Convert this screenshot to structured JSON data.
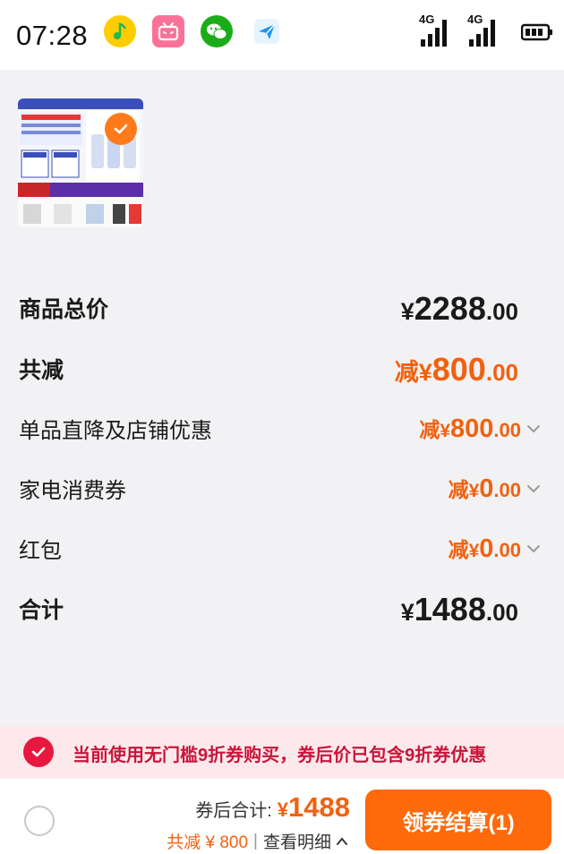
{
  "status_bar": {
    "time": "07:28",
    "apps": [
      "music-icon",
      "bilibili-icon",
      "wechat-icon",
      "send-icon"
    ],
    "signal_1_label": "4G",
    "signal_2_label": "4G"
  },
  "rows": {
    "product_total": {
      "label": "商品总价",
      "yen": "¥",
      "int": "2288",
      "dec": ".00"
    },
    "total_reduction": {
      "label": "共减",
      "prefix": "减",
      "yen": "¥",
      "int": "800",
      "dec": ".00"
    },
    "store_discount": {
      "label": "单品直降及店铺优惠",
      "prefix": "减",
      "yen": "¥",
      "int": "800",
      "dec": ".00"
    },
    "appliance_coupon": {
      "label": "家电消费券",
      "prefix": "减",
      "yen": "¥",
      "int": "0",
      "dec": ".00"
    },
    "red_packet": {
      "label": "红包",
      "prefix": "减",
      "yen": "¥",
      "int": "0",
      "dec": ".00"
    },
    "grand_total": {
      "label": "合计",
      "yen": "¥",
      "int": "1488",
      "dec": ".00"
    }
  },
  "notice": {
    "text": "当前使用无门槛9折券购买，券后价已包含9折券优惠"
  },
  "bottom_bar": {
    "total_label": "券后合计:",
    "total_yen": "¥",
    "total_amount": "1488",
    "save_text": "共减 ¥ 800",
    "separator": "|",
    "detail_link": "查看明细",
    "checkout_label": "领券结算(1)"
  },
  "colors": {
    "accent_orange": "#ff6a0a",
    "discount_orange": "#f2610f",
    "notice_red": "#e8173f",
    "notice_bg": "#fde9ec"
  }
}
